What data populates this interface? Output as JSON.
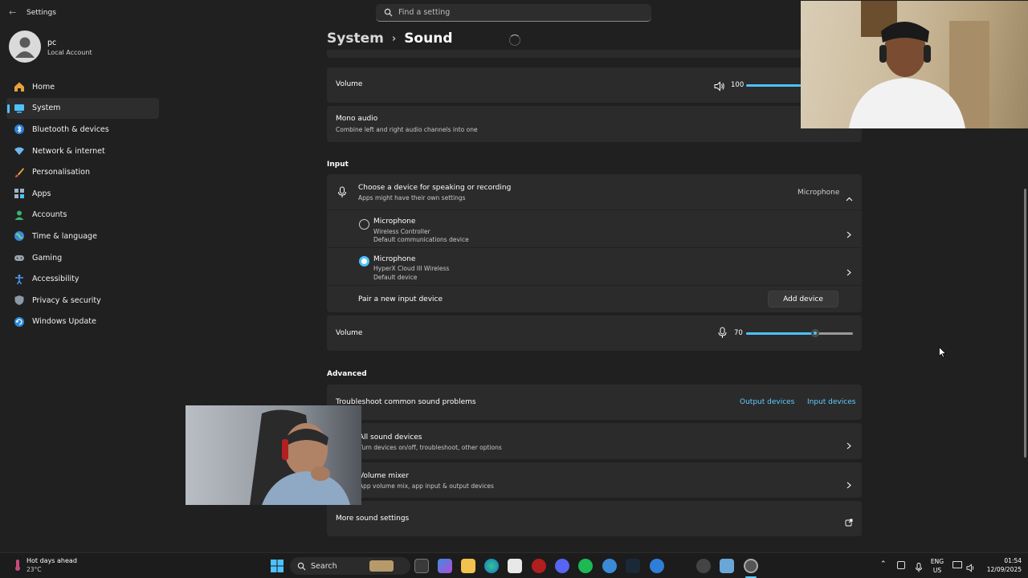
{
  "app": {
    "title": "Settings"
  },
  "search": {
    "placeholder": "Find a setting"
  },
  "profile": {
    "name": "pc",
    "account_type": "Local Account"
  },
  "sidebar": {
    "items": [
      {
        "label": "Home",
        "icon": "home-icon"
      },
      {
        "label": "System",
        "icon": "system-icon",
        "active": true
      },
      {
        "label": "Bluetooth & devices",
        "icon": "bluetooth-icon"
      },
      {
        "label": "Network & internet",
        "icon": "wifi-icon"
      },
      {
        "label": "Personalisation",
        "icon": "brush-icon"
      },
      {
        "label": "Apps",
        "icon": "apps-icon"
      },
      {
        "label": "Accounts",
        "icon": "accounts-icon"
      },
      {
        "label": "Time & language",
        "icon": "globe-icon"
      },
      {
        "label": "Gaming",
        "icon": "gamepad-icon"
      },
      {
        "label": "Accessibility",
        "icon": "accessibility-icon"
      },
      {
        "label": "Privacy & security",
        "icon": "shield-icon"
      },
      {
        "label": "Windows Update",
        "icon": "update-icon"
      }
    ]
  },
  "header": {
    "crumb_parent": "System",
    "crumb_current": "Sound"
  },
  "output": {
    "volume_label": "Volume",
    "volume_value": "100",
    "volume_level": 1.0,
    "mono_title": "Mono audio",
    "mono_sub": "Combine left and right audio channels into one"
  },
  "input": {
    "section_label": "Input",
    "choose_title": "Choose a device for speaking or recording",
    "choose_sub": "Apps might have their own settings",
    "selected_device": "Microphone",
    "devices": [
      {
        "name": "Microphone",
        "line1": "Wireless Controller",
        "line2": "Default communications device",
        "selected": false
      },
      {
        "name": "Microphone",
        "line1": "HyperX Cloud III Wireless",
        "line2": "Default device",
        "selected": true
      }
    ],
    "pair_label": "Pair a new input device",
    "add_device_label": "Add device",
    "volume_label": "Volume",
    "volume_value": "70",
    "volume_level": 0.7
  },
  "advanced": {
    "section_label": "Advanced",
    "troubleshoot_label": "Troubleshoot common sound problems",
    "output_devices_link": "Output devices",
    "input_devices_link": "Input devices",
    "all_devices_title": "All sound devices",
    "all_devices_sub": "Turn devices on/off, troubleshoot, other options",
    "mixer_title": "Volume mixer",
    "mixer_sub": "App volume mix, app input & output devices",
    "more_settings_label": "More sound settings"
  },
  "taskbar": {
    "weather_title": "Hot days ahead",
    "weather_temp": "23°C",
    "search_label": "Search",
    "lang_top": "ENG",
    "lang_bottom": "US",
    "time": "01:54",
    "date": "12/09/2025"
  },
  "colors": {
    "accent": "#4cc2ff",
    "background": "#202020",
    "card": "#2b2b2b"
  }
}
